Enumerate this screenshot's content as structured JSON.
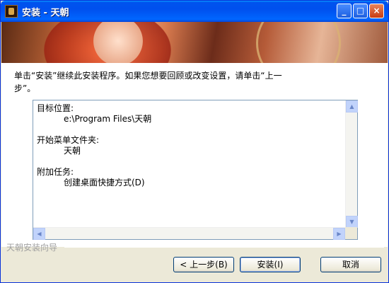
{
  "window": {
    "title": "安装 - 天朝",
    "controls": {
      "minimize": "_",
      "maximize": "□",
      "close": "×"
    }
  },
  "instruction_line1": "单击“安装”继续此安装程序。如果您想要回顾或改变设置，请单击“上一",
  "instruction_line2": "步”。",
  "summary": {
    "dest_label": "目标位置:",
    "dest_value": "e:\\Program Files\\天朝",
    "menu_label": "开始菜单文件夹:",
    "menu_value": "天朝",
    "tasks_label": "附加任务:",
    "tasks_value": "创建桌面快捷方式(D)"
  },
  "footer": {
    "brand": "天朝安装向导"
  },
  "buttons": {
    "back": "< 上一步(B)",
    "install": "安装(I)",
    "cancel": "取消"
  },
  "icons": {
    "app": "game-app-icon",
    "scroll_up": "▲",
    "scroll_down": "▼",
    "scroll_left": "◀",
    "scroll_right": "▶"
  },
  "colors": {
    "titlebar": "#0053ee",
    "dialog_bg": "#ece9d8",
    "border": "#7f9db9"
  }
}
